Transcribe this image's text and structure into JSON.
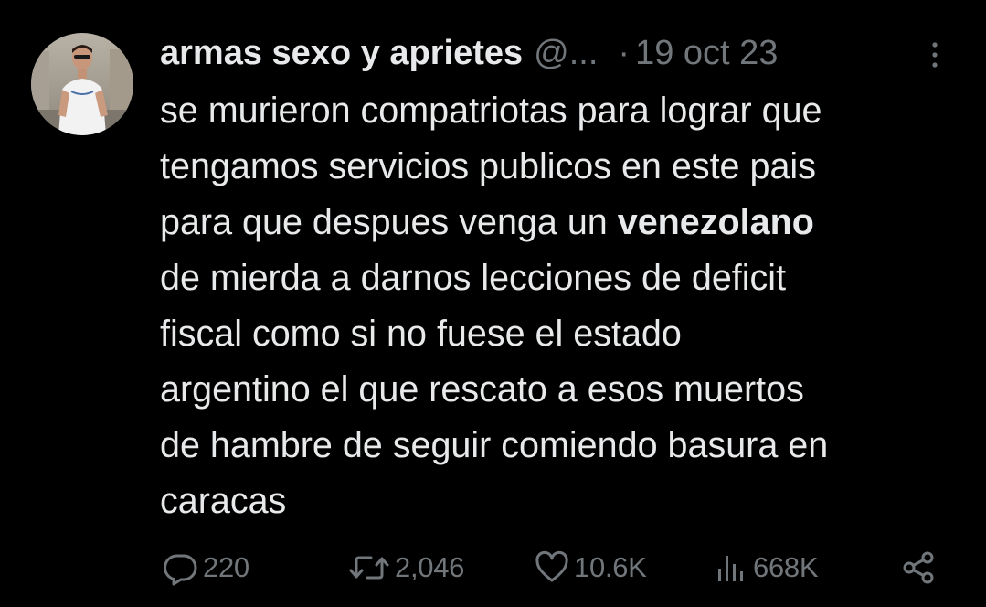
{
  "tweet": {
    "author": {
      "display_name": "armas sexo y aprietes",
      "handle": "@...",
      "avatar_icon": "user-avatar-photo"
    },
    "separator": "·",
    "date": "19 oct 23",
    "body_lines": [
      "se murieron compatriotas para lograr que",
      "tengamos servicios publicos en este pais",
      [
        "para que despues venga un ",
        "venezolano"
      ],
      "de mierda a darnos lecciones de deficit",
      "fiscal como si no fuese el estado",
      "argentino el que rescato a esos muertos",
      "de hambre de seguir comiendo basura en",
      "caracas"
    ],
    "body": {
      "line1": "se murieron compatriotas para lograr que",
      "line2": "tengamos servicios publicos en este pais",
      "line3_prefix": "para que despues venga un ",
      "line3_bold": "venezolano",
      "line4": "de mierda a darnos lecciones de deficit",
      "line5": "fiscal como si no fuese el estado",
      "line6": "argentino el que rescato a esos muertos",
      "line7": "de hambre de seguir comiendo basura en",
      "line8": "caracas"
    },
    "actions": {
      "replies": {
        "icon": "reply-icon",
        "count": "220"
      },
      "retweets": {
        "icon": "retweet-icon",
        "count": "2,046"
      },
      "likes": {
        "icon": "heart-icon",
        "count": "10.6K"
      },
      "views": {
        "icon": "views-icon",
        "count": "668K"
      },
      "share": {
        "icon": "share-icon"
      }
    },
    "more_icon": "more-options-icon"
  },
  "colors": {
    "background": "#000000",
    "text_primary": "#e7e9ea",
    "text_secondary": "#71767b"
  }
}
